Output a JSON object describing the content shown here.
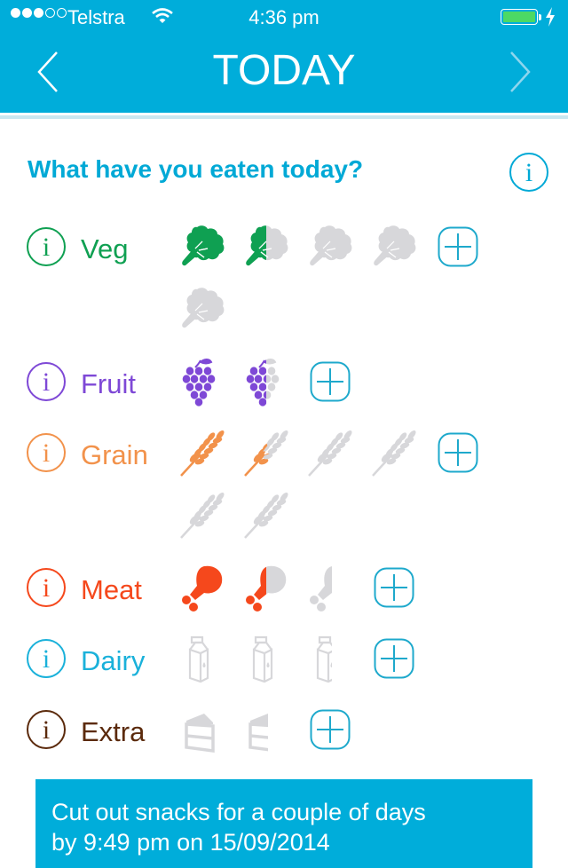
{
  "status_bar": {
    "signal_strength": 3,
    "signal_max": 5,
    "carrier": "Telstra",
    "time": "4:36 pm",
    "battery_level": 1.0,
    "charging": true
  },
  "nav": {
    "title": "TODAY",
    "back_icon": "chevron-left-icon",
    "forward_icon": "chevron-right-icon"
  },
  "main": {
    "heading": "What have you eaten today?",
    "categories": [
      {
        "name": "Veg",
        "color": "#0FA052",
        "icon": "broccoli",
        "servings_target": 5,
        "servings_eaten": 1.5
      },
      {
        "name": "Fruit",
        "color": "#7E48D6",
        "icon": "grapes",
        "servings_target": 2,
        "servings_eaten": 1.5
      },
      {
        "name": "Grain",
        "color": "#F2924B",
        "icon": "wheat",
        "servings_target": 6,
        "servings_eaten": 1.5
      },
      {
        "name": "Meat",
        "color": "#F5481C",
        "icon": "drumstick",
        "servings_target": 2.5,
        "servings_eaten": 1.5
      },
      {
        "name": "Dairy",
        "color": "#1AB1DA",
        "icon": "milk-carton",
        "servings_target": 2.5,
        "servings_eaten": 0
      },
      {
        "name": "Extra",
        "color": "#5B2A0C",
        "icon": "cake",
        "servings_target": 1.5,
        "servings_eaten": 0
      }
    ]
  },
  "banner": {
    "line1": "Cut out snacks for a couple of days",
    "line2": "by 9:49 pm on 15/09/2014"
  },
  "colors": {
    "brand": "#00ADDA",
    "inactive_icon": "#D7D7DA",
    "plus_button": "#1EA9CC"
  }
}
